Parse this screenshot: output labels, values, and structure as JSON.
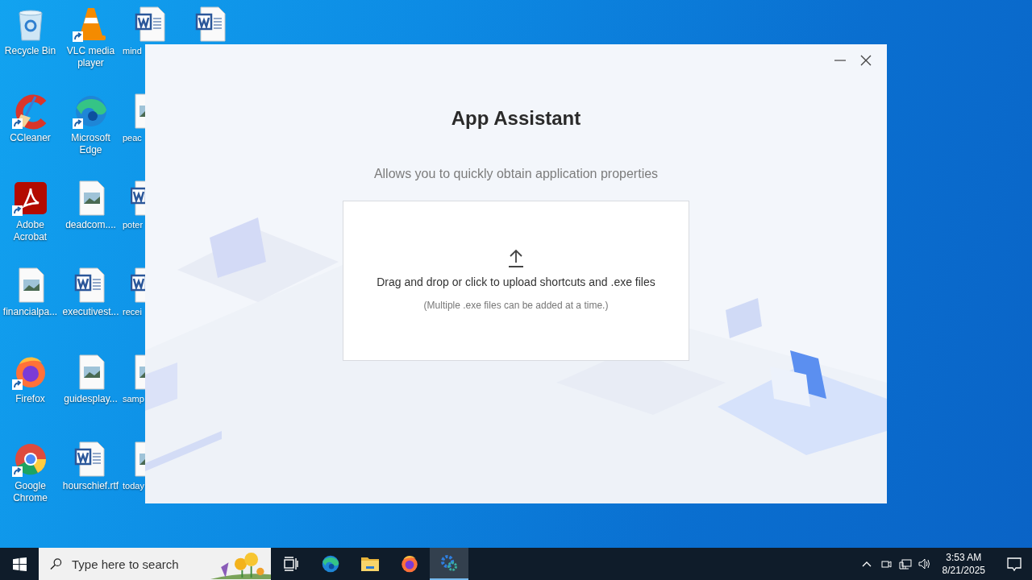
{
  "desktop": {
    "columns": [
      [
        {
          "label": "Recycle Bin",
          "kind": "recycle",
          "shortcut": false
        },
        {
          "label": "CCleaner",
          "kind": "ccleaner",
          "shortcut": true
        },
        {
          "label": "Adobe Acrobat",
          "kind": "acrobat",
          "shortcut": true
        },
        {
          "label": "financialpa...",
          "kind": "image",
          "shortcut": false
        },
        {
          "label": "Firefox",
          "kind": "firefox",
          "shortcut": true
        },
        {
          "label": "Google Chrome",
          "kind": "chrome",
          "shortcut": true
        }
      ],
      [
        {
          "label": "VLC media player",
          "kind": "vlc",
          "shortcut": true
        },
        {
          "label": "Microsoft Edge",
          "kind": "edge",
          "shortcut": true
        },
        {
          "label": "deadcom....",
          "kind": "image",
          "shortcut": false
        },
        {
          "label": "executivest...",
          "kind": "word",
          "shortcut": false
        },
        {
          "label": "guidesplay...",
          "kind": "image",
          "shortcut": false
        },
        {
          "label": "hourschief.rtf",
          "kind": "word",
          "shortcut": false
        }
      ],
      [
        {
          "label": "mind",
          "kind": "word",
          "shortcut": false
        },
        {
          "label": "peac",
          "kind": "image",
          "shortcut": false
        },
        {
          "label": "poter",
          "kind": "word",
          "shortcut": false
        },
        {
          "label": "recei",
          "kind": "word",
          "shortcut": false
        },
        {
          "label": "samp",
          "kind": "image",
          "shortcut": false
        },
        {
          "label": "today",
          "kind": "image",
          "shortcut": false
        }
      ],
      [
        {
          "kind": "word",
          "shortcut": false
        }
      ]
    ]
  },
  "window": {
    "title": "App Assistant",
    "subtitle": "Allows you to quickly obtain application properties",
    "drop_zone": {
      "text": "Drag and drop or click to upload shortcuts and .exe files",
      "hint": "(Multiple .exe files can be added at a time.)"
    }
  },
  "taskbar": {
    "search": {
      "placeholder": "Type here to search"
    },
    "apps": [
      {
        "kind": "task-view",
        "selected": false
      },
      {
        "kind": "edge",
        "selected": false
      },
      {
        "kind": "explorer",
        "selected": false
      },
      {
        "kind": "firefox",
        "selected": false
      },
      {
        "kind": "gear",
        "selected": true
      }
    ],
    "clock": {
      "time": "3:53 AM",
      "date": "8/21/2025"
    }
  }
}
